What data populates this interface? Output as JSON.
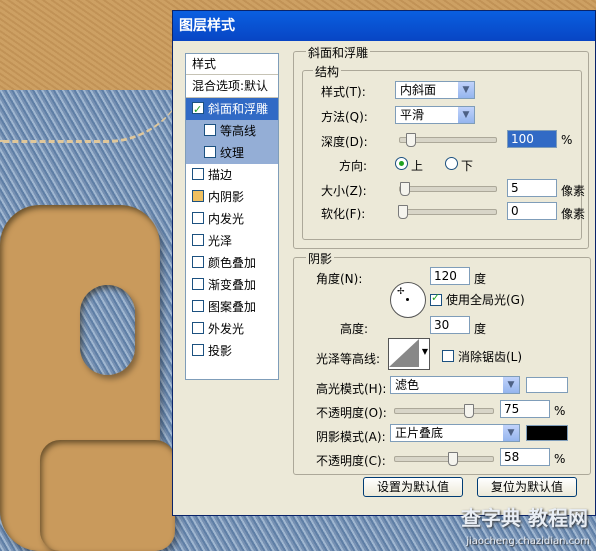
{
  "dialog": {
    "title": "图层样式"
  },
  "left_panel": {
    "header": "样式",
    "items": [
      {
        "label": "混合选项:默认",
        "checkbox": false,
        "checked": false,
        "selected": false
      },
      {
        "label": "斜面和浮雕",
        "checkbox": true,
        "checked": true,
        "selected": true
      },
      {
        "label": "等高线",
        "checkbox": true,
        "checked": false,
        "selected": false,
        "sub": true
      },
      {
        "label": "纹理",
        "checkbox": true,
        "checked": false,
        "selected": false,
        "sub": true
      },
      {
        "label": "描边",
        "checkbox": true,
        "checked": false
      },
      {
        "label": "内阴影",
        "checkbox": true,
        "checked": false
      },
      {
        "label": "内发光",
        "checkbox": true,
        "checked": false
      },
      {
        "label": "光泽",
        "checkbox": true,
        "checked": false
      },
      {
        "label": "颜色叠加",
        "checkbox": true,
        "checked": false
      },
      {
        "label": "渐变叠加",
        "checkbox": true,
        "checked": false
      },
      {
        "label": "图案叠加",
        "checkbox": true,
        "checked": false
      },
      {
        "label": "外发光",
        "checkbox": true,
        "checked": false
      },
      {
        "label": "投影",
        "checkbox": true,
        "checked": false
      }
    ]
  },
  "bevel": {
    "section_title": "斜面和浮雕",
    "structure_title": "结构",
    "style_label": "样式(T):",
    "style_value": "内斜面",
    "method_label": "方法(Q):",
    "method_value": "平滑",
    "depth_label": "深度(D):",
    "depth_value": "100",
    "depth_unit": "%",
    "depth_fraction": 0.1,
    "direction_label": "方向:",
    "direction_up": "上",
    "direction_down": "下",
    "direction_selected": "上",
    "size_label": "大小(Z):",
    "size_value": "5",
    "size_unit": "像素",
    "size_fraction": 0.02,
    "soften_label": "软化(F):",
    "soften_value": "0",
    "soften_unit": "像素",
    "soften_fraction": 0.0
  },
  "shading": {
    "title": "阴影",
    "angle_label": "角度(N):",
    "angle_value": "120",
    "angle_unit": "度",
    "global_light_label": "使用全局光(G)",
    "global_light_checked": true,
    "altitude_label": "高度:",
    "altitude_value": "30",
    "altitude_unit": "度",
    "gloss_label": "光泽等高线:",
    "antialias_label": "消除锯齿(L)",
    "antialias_checked": false,
    "highlight_mode_label": "高光模式(H):",
    "highlight_mode_value": "滤色",
    "highlight_color": "#ffffff",
    "highlight_opacity_label": "不透明度(O):",
    "highlight_opacity_value": "75",
    "highlight_opacity_unit": "%",
    "highlight_opacity_fraction": 0.75,
    "shadow_mode_label": "阴影模式(A):",
    "shadow_mode_value": "正片叠底",
    "shadow_color": "#000000",
    "shadow_opacity_label": "不透明度(C):",
    "shadow_opacity_value": "58",
    "shadow_opacity_unit": "%",
    "shadow_opacity_fraction": 0.58
  },
  "buttons": {
    "make_default": "设置为默认值",
    "reset_default": "复位为默认值"
  },
  "watermark": {
    "title": "查字典 教程网",
    "url": "jiaocheng.chazidian.com"
  }
}
